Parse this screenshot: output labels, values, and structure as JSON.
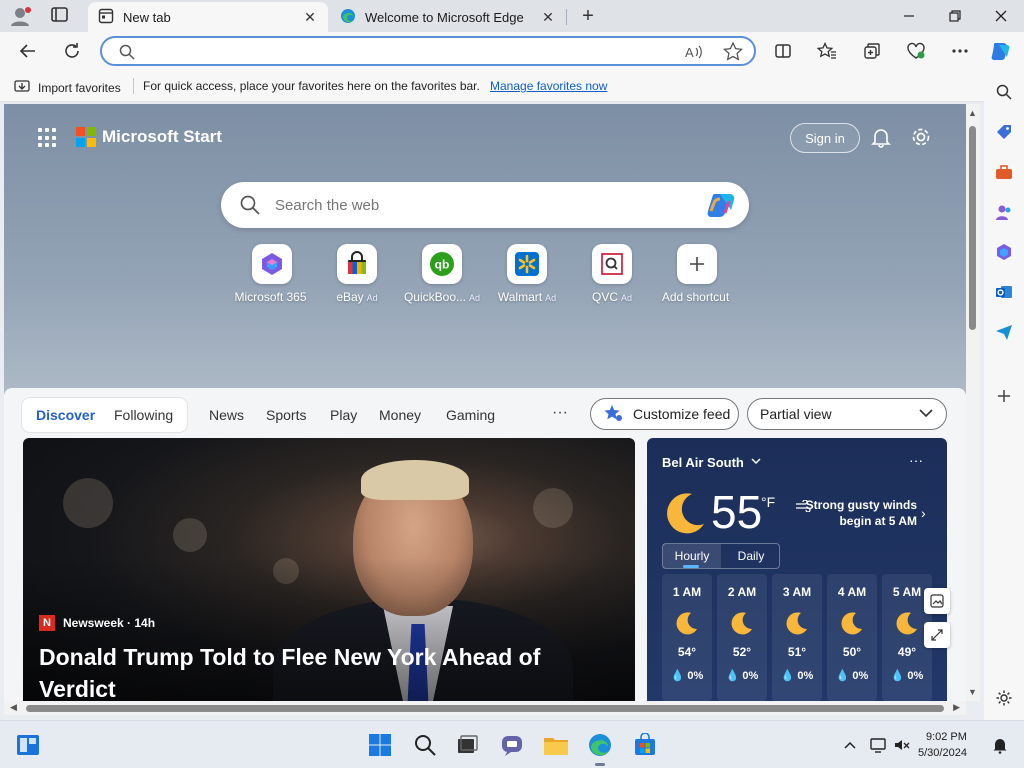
{
  "browser": {
    "tabs": [
      {
        "title": "New tab",
        "active": true,
        "icon": "newtab-page-icon"
      },
      {
        "title": "Welcome to Microsoft Edge",
        "active": false,
        "icon": "edge-logo-icon"
      }
    ],
    "address": {
      "value": "",
      "placeholder": ""
    }
  },
  "favorites_bar": {
    "import_label": "Import favorites",
    "message": "For quick access, place your favorites here on the favorites bar.",
    "manage_link": "Manage favorites now"
  },
  "page": {
    "brand": "Microsoft Start",
    "sign_in": "Sign in",
    "search_placeholder": "Search the web",
    "shortcuts": [
      {
        "label": "Microsoft 365",
        "ad": "",
        "icon": "microsoft365-icon"
      },
      {
        "label": "eBay",
        "ad": "Ad",
        "icon": "ebay-icon"
      },
      {
        "label": "QuickBoo...",
        "ad": "Ad",
        "icon": "quickbooks-icon"
      },
      {
        "label": "Walmart",
        "ad": "Ad",
        "icon": "walmart-icon"
      },
      {
        "label": "QVC",
        "ad": "Ad",
        "icon": "qvc-icon"
      },
      {
        "label": "Add shortcut",
        "ad": "",
        "icon": "plus-icon"
      }
    ]
  },
  "feed": {
    "segments": [
      "Discover",
      "Following"
    ],
    "active_segment": "Discover",
    "nav": [
      "News",
      "Sports",
      "Play",
      "Money",
      "Gaming"
    ],
    "more": "···",
    "customize": "Customize feed",
    "view": "Partial view",
    "hero": {
      "source": "Newsweek",
      "age": "14h",
      "source_line": "Newsweek · 14h",
      "headline": "Donald Trump Told to Flee New York Ahead of Verdict"
    }
  },
  "weather": {
    "location": "Bel Air South",
    "temp": "55",
    "unit": "°F",
    "alert": "Strong gusty winds begin at 5 AM",
    "tabs": [
      "Hourly",
      "Daily"
    ],
    "active_tab": "Hourly",
    "hours": [
      {
        "time": "1 AM",
        "temp": "54°",
        "precip": "0%"
      },
      {
        "time": "2 AM",
        "temp": "52°",
        "precip": "0%"
      },
      {
        "time": "3 AM",
        "temp": "51°",
        "precip": "0%"
      },
      {
        "time": "4 AM",
        "temp": "50°",
        "precip": "0%"
      },
      {
        "time": "5 AM",
        "temp": "49°",
        "precip": "0%"
      }
    ]
  },
  "taskbar": {
    "time": "9:02 PM",
    "date": "5/30/2024"
  },
  "colors": {
    "accent": "#2360c7",
    "link": "#0f5fc3",
    "weather_bg": "#1c2e58"
  }
}
